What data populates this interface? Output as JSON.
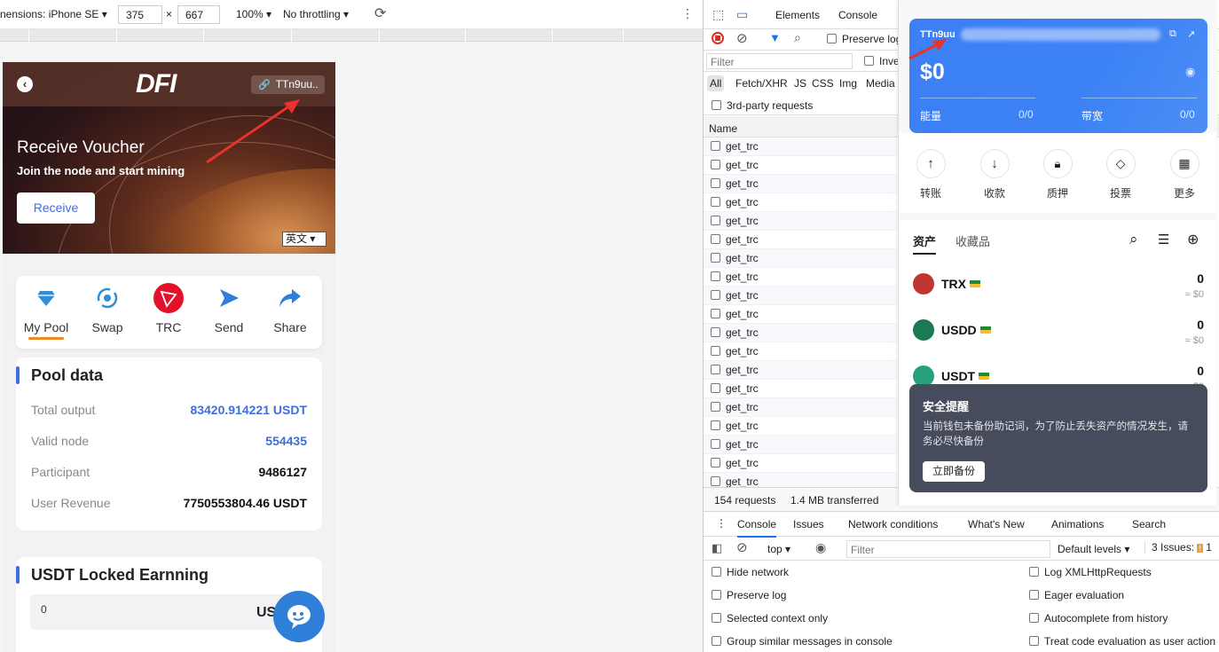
{
  "device_toolbar": {
    "dimensions_label": "nensions: iPhone SE",
    "width": "375",
    "times": "×",
    "height": "667",
    "zoom": "100%",
    "throttling": "No throttling"
  },
  "page": {
    "header": {
      "logo": "DFI",
      "address_chip": "TTn9uu.."
    },
    "hero": {
      "title": "Receive Voucher",
      "subtitle": "Join the node and start mining",
      "receive_button": "Receive",
      "language": "英文"
    },
    "quick_actions": [
      {
        "label": "My Pool",
        "icon": "diamond-icon",
        "active": true
      },
      {
        "label": "Swap",
        "icon": "swap-icon",
        "active": false
      },
      {
        "label": "TRC",
        "icon": "tron-icon",
        "active": false
      },
      {
        "label": "Send",
        "icon": "send-arrow-icon",
        "active": false
      },
      {
        "label": "Share",
        "icon": "share-arrow-icon",
        "active": false
      }
    ],
    "pool_data": {
      "title": "Pool data",
      "rows": [
        {
          "label": "Total output",
          "value": "83420.914221 USDT",
          "highlight": true
        },
        {
          "label": "Valid node",
          "value": "554435",
          "highlight": true
        },
        {
          "label": "Participant",
          "value": "9486127",
          "highlight": false
        },
        {
          "label": "User Revenue",
          "value": "7750553804.46 USDT",
          "highlight": false
        }
      ]
    },
    "locked": {
      "title": "USDT Locked Earnning",
      "value": "0",
      "unit": "US"
    },
    "accent": "#3e6edb"
  },
  "devtools": {
    "tabs": [
      "Elements",
      "Console"
    ],
    "preserve_log": "Preserve log",
    "filter_placeholder": "Filter",
    "invert": "Inve",
    "types": [
      "All",
      "Fetch/XHR",
      "JS",
      "CSS",
      "Img",
      "Media"
    ],
    "third_party": "3rd-party requests",
    "name_header": "Name",
    "requests": [
      "get_trc",
      "get_trc",
      "get_trc",
      "get_trc",
      "get_trc",
      "get_trc",
      "get_trc",
      "get_trc",
      "get_trc",
      "get_trc",
      "get_trc",
      "get_trc",
      "get_trc",
      "get_trc",
      "get_trc",
      "get_trc",
      "get_trc",
      "get_trc",
      "get_trc"
    ],
    "status": {
      "requests": "154 requests",
      "transferred": "1.4 MB transferred"
    },
    "drawer_tabs": [
      "Console",
      "Issues",
      "Network conditions",
      "What's New",
      "Animations",
      "Search"
    ],
    "console": {
      "context": "top",
      "filter_placeholder": "Filter",
      "levels": "Default levels",
      "issues": "3 Issues:",
      "issues_count": "1",
      "settings_left": [
        "Hide network",
        "Preserve log",
        "Selected context only",
        "Group similar messages in console"
      ],
      "settings_right": [
        "Log XMLHttpRequests",
        "Eager evaluation",
        "Autocomplete from history",
        "Treat code evaluation as user action"
      ]
    }
  },
  "wallet": {
    "address": "TTn9uu",
    "balance": "$0",
    "energy_label": "能量",
    "energy_value": "0/0",
    "bandwidth_label": "带宽",
    "bandwidth_value": "0/0",
    "actions": [
      {
        "label": "转账",
        "icon": "arrow-up-icon"
      },
      {
        "label": "收款",
        "icon": "arrow-down-icon"
      },
      {
        "label": "质押",
        "icon": "lock-icon"
      },
      {
        "label": "投票",
        "icon": "vote-icon"
      },
      {
        "label": "更多",
        "icon": "grid-icon"
      }
    ],
    "tabs": [
      "资产",
      "收藏品"
    ],
    "tokens": [
      {
        "name": "TRX",
        "qty": "0",
        "fiat": "≈ $0",
        "color": "#c23631"
      },
      {
        "name": "USDD",
        "qty": "0",
        "fiat": "≈ $0",
        "color": "#1b7a52"
      },
      {
        "name": "USDT",
        "qty": "0",
        "fiat": "≈ $0",
        "color": "#26a17b"
      }
    ],
    "toast": {
      "title": "安全提醒",
      "body": "当前钱包未备份助记词，为了防止丢失资产的情况发生，请务必尽快备份",
      "button": "立即备份"
    }
  }
}
